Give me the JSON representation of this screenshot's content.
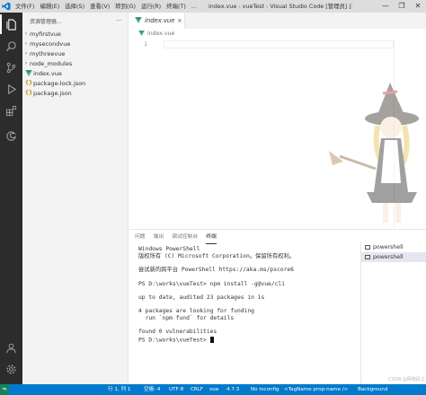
{
  "titlebar": {
    "menu": [
      "文件(F)",
      "编辑(E)",
      "选择(S)",
      "查看(V)",
      "转到(G)",
      "运行(R)",
      "终端(T)",
      "..."
    ],
    "window_title": "index.vue - vueTest - Visual Studio Code [管理员] [不...",
    "controls": [
      "—",
      "❐",
      "✕"
    ]
  },
  "explorer": {
    "header": "资源管理器...",
    "more": "···",
    "items": [
      {
        "label": "myfirstvue",
        "kind": "folder"
      },
      {
        "label": "mysecondvue",
        "kind": "folder"
      },
      {
        "label": "mythreevue",
        "kind": "folder"
      },
      {
        "label": "node_modules",
        "kind": "folder"
      },
      {
        "label": "index.vue",
        "kind": "vue"
      },
      {
        "label": "package-lock.json",
        "kind": "json"
      },
      {
        "label": "package.json",
        "kind": "json"
      }
    ],
    "folder_chevron": "›",
    "json_glyph": "{}"
  },
  "editor": {
    "tab_label": "index.vue",
    "tab_close": "✕",
    "breadcrumb": "index.vue",
    "line_number": "1"
  },
  "panel": {
    "tabs": [
      "问题",
      "输出",
      "调试控制台",
      "终端"
    ],
    "terminal_lines": [
      "Windows PowerShell",
      "版权所有 (C) Microsoft Corporation。保留所有权利。",
      "",
      "尝试新的跨平台 PowerShell https://aka.ms/pscore6",
      "",
      "PS D:\\works\\vueTest> npm install -g@vue/cli",
      "",
      "up to date, audited 23 packages in 1s",
      "",
      "4 packages are looking for funding",
      "  run `npm fund` for details",
      "",
      "found 0 vulnerabilities"
    ],
    "prompt": "PS D:\\works\\vueTest> ",
    "terminals": [
      "powershell",
      "powershell"
    ]
  },
  "statusbar": {
    "remote": "⇋",
    "position": "行 1, 列 1",
    "spaces": "空格: 4",
    "encoding": "UTF-8",
    "eol": "CRLF",
    "language": "vue",
    "version": "4.7.3",
    "tsconfig": "No tsconfig",
    "tag": "<TagName prop-name />",
    "background": "Background",
    "watermark": "CSDN @网络民工~"
  },
  "colors": {
    "activity_bar": "#2c2c2c",
    "status_bar": "#007acc",
    "vue_green": "#41b883",
    "json_yellow": "#b89500"
  }
}
